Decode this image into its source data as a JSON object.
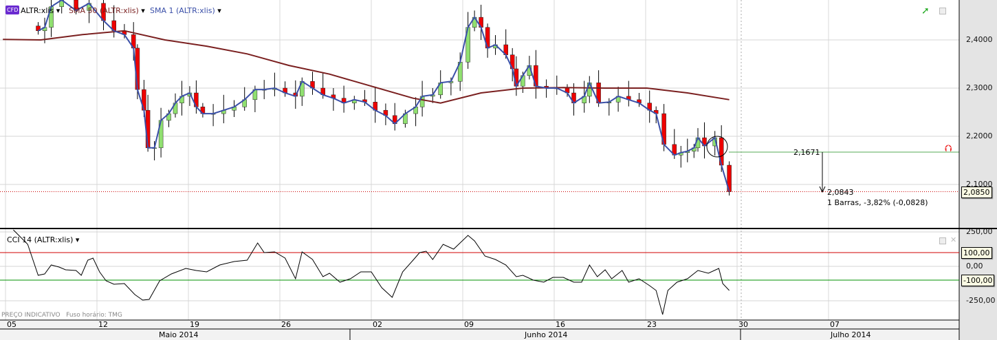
{
  "legend": {
    "symbol": "ALTR:xlis",
    "sma50": "SMA 50 (ALTR:xlis)",
    "sma1": "SMA 1 (ALTR:xlis)",
    "cfd_badge": "CFD"
  },
  "cci_legend": "CCI 14 (ALTR:xlis)",
  "footer": {
    "indicative": "PREÇO INDICATIVO",
    "timezone": "Fuso horário: TMG"
  },
  "price_tag": "2,0850",
  "cci_tags": {
    "upper": "100,00",
    "lower": "-100,00"
  },
  "measure": {
    "start": "2,1671",
    "end": "2,0843",
    "summary": "1 Barras, -3,82% (-0,0828)"
  },
  "colors": {
    "sma50": "#7a1f1f",
    "sma1": "#3a4fa8",
    "up": "#90e070",
    "down": "#ee0000",
    "cci_upper": "#d00000",
    "cci_lower": "#009000"
  },
  "chart_data": [
    {
      "type": "candlestick+line",
      "title": "ALTR:xlis",
      "ylim": [
        2.02,
        2.48
      ],
      "y_ticks": [
        "2,4000",
        "2,3000",
        "2,2000",
        "2,1000"
      ],
      "y_tick_values": [
        2.4,
        2.3,
        2.2,
        2.1
      ],
      "x_ticks": [
        "05",
        "12",
        "19",
        "26",
        "02",
        "09",
        "16",
        "23",
        "30",
        "07"
      ],
      "x_tick_days": [
        0,
        7,
        14,
        21,
        28,
        35,
        42,
        49,
        56,
        63
      ],
      "months": [
        "Maio 2014",
        "Junho 2014",
        "Julho 2014"
      ],
      "close_series": [
        [
          2.5,
          2.419
        ],
        [
          3.0,
          2.426
        ],
        [
          3.5,
          2.469
        ],
        [
          4.3,
          2.483
        ],
        [
          5.4,
          2.461
        ],
        [
          6.4,
          2.476
        ],
        [
          7.5,
          2.44
        ],
        [
          8.3,
          2.419
        ],
        [
          9.1,
          2.411
        ],
        [
          9.8,
          2.383
        ],
        [
          10.1,
          2.297
        ],
        [
          10.6,
          2.254
        ],
        [
          10.9,
          2.176
        ],
        [
          11.4,
          2.176
        ],
        [
          11.9,
          2.233
        ],
        [
          12.5,
          2.247
        ],
        [
          13.0,
          2.269
        ],
        [
          13.5,
          2.283
        ],
        [
          14.1,
          2.29
        ],
        [
          14.6,
          2.261
        ],
        [
          15.1,
          2.247
        ],
        [
          15.9,
          2.247
        ],
        [
          16.7,
          2.254
        ],
        [
          17.5,
          2.261
        ],
        [
          18.3,
          2.276
        ],
        [
          19.1,
          2.297
        ],
        [
          19.8,
          2.297
        ],
        [
          20.6,
          2.3
        ],
        [
          21.4,
          2.29
        ],
        [
          22.2,
          2.283
        ],
        [
          22.7,
          2.314
        ],
        [
          23.5,
          2.3
        ],
        [
          24.3,
          2.286
        ],
        [
          25.1,
          2.279
        ],
        [
          25.9,
          2.269
        ],
        [
          26.7,
          2.276
        ],
        [
          27.5,
          2.271
        ],
        [
          28.3,
          2.254
        ],
        [
          29.1,
          2.243
        ],
        [
          29.8,
          2.226
        ],
        [
          30.6,
          2.247
        ],
        [
          31.4,
          2.261
        ],
        [
          31.9,
          2.283
        ],
        [
          32.7,
          2.286
        ],
        [
          33.3,
          2.311
        ],
        [
          34.1,
          2.314
        ],
        [
          34.8,
          2.354
        ],
        [
          35.4,
          2.426
        ],
        [
          35.9,
          2.447
        ],
        [
          36.4,
          2.426
        ],
        [
          36.9,
          2.383
        ],
        [
          37.5,
          2.39
        ],
        [
          38.3,
          2.369
        ],
        [
          38.8,
          2.34
        ],
        [
          39.1,
          2.304
        ],
        [
          39.6,
          2.326
        ],
        [
          40.1,
          2.347
        ],
        [
          40.6,
          2.304
        ],
        [
          41.4,
          2.3
        ],
        [
          42.2,
          2.3
        ],
        [
          43.0,
          2.29
        ],
        [
          43.5,
          2.269
        ],
        [
          44.3,
          2.283
        ],
        [
          44.7,
          2.311
        ],
        [
          45.4,
          2.269
        ],
        [
          46.2,
          2.271
        ],
        [
          46.9,
          2.283
        ],
        [
          47.7,
          2.276
        ],
        [
          48.5,
          2.269
        ],
        [
          49.3,
          2.254
        ],
        [
          49.8,
          2.247
        ],
        [
          50.4,
          2.183
        ],
        [
          51.2,
          2.161
        ],
        [
          51.7,
          2.166
        ],
        [
          52.2,
          2.169
        ],
        [
          52.7,
          2.176
        ],
        [
          53.0,
          2.197
        ],
        [
          53.5,
          2.18
        ],
        [
          54.3,
          2.197
        ],
        [
          54.8,
          2.14
        ],
        [
          55.4,
          2.085
        ]
      ],
      "sma50_series": [
        [
          -0.2,
          2.401
        ],
        [
          2.7,
          2.4
        ],
        [
          5.9,
          2.411
        ],
        [
          9.1,
          2.419
        ],
        [
          12.2,
          2.4
        ],
        [
          15.4,
          2.387
        ],
        [
          18.5,
          2.371
        ],
        [
          21.7,
          2.347
        ],
        [
          24.8,
          2.329
        ],
        [
          28.0,
          2.304
        ],
        [
          31.2,
          2.279
        ],
        [
          33.3,
          2.269
        ],
        [
          36.4,
          2.29
        ],
        [
          39.6,
          2.3
        ],
        [
          42.7,
          2.301
        ],
        [
          45.9,
          2.3
        ],
        [
          49.1,
          2.3
        ],
        [
          52.2,
          2.29
        ],
        [
          55.4,
          2.276
        ]
      ],
      "last_price": 2.085,
      "measure_from": 2.1671,
      "measure_to": 2.0843
    },
    {
      "type": "line",
      "title": "CCI 14 (ALTR:xlis)",
      "ylim": [
        -400,
        300
      ],
      "y_ticks": [
        "250,00",
        "0,00",
        "-250,00"
      ],
      "y_tick_values": [
        250,
        0,
        -250
      ],
      "levels": [
        100,
        -100
      ],
      "series": [
        [
          0.6,
          300
        ],
        [
          1.7,
          160
        ],
        [
          2.5,
          -65
        ],
        [
          3.0,
          -55
        ],
        [
          3.5,
          10
        ],
        [
          4.1,
          -5
        ],
        [
          4.6,
          -25
        ],
        [
          5.4,
          -30
        ],
        [
          5.8,
          -65
        ],
        [
          6.3,
          45
        ],
        [
          6.7,
          60
        ],
        [
          7.2,
          -40
        ],
        [
          7.7,
          -105
        ],
        [
          8.3,
          -130
        ],
        [
          9.1,
          -125
        ],
        [
          9.9,
          -205
        ],
        [
          10.5,
          -245
        ],
        [
          11.0,
          -240
        ],
        [
          11.8,
          -105
        ],
        [
          12.7,
          -55
        ],
        [
          13.8,
          -15
        ],
        [
          14.6,
          -30
        ],
        [
          15.4,
          -40
        ],
        [
          16.4,
          10
        ],
        [
          17.5,
          35
        ],
        [
          18.5,
          45
        ],
        [
          19.3,
          170
        ],
        [
          19.8,
          100
        ],
        [
          20.6,
          105
        ],
        [
          21.4,
          60
        ],
        [
          22.2,
          -90
        ],
        [
          22.7,
          105
        ],
        [
          23.5,
          50
        ],
        [
          24.3,
          -75
        ],
        [
          24.8,
          -50
        ],
        [
          25.6,
          -115
        ],
        [
          26.4,
          -90
        ],
        [
          27.2,
          -40
        ],
        [
          28.0,
          -40
        ],
        [
          28.8,
          -155
        ],
        [
          29.6,
          -225
        ],
        [
          30.4,
          -40
        ],
        [
          31.2,
          45
        ],
        [
          31.7,
          100
        ],
        [
          32.2,
          110
        ],
        [
          32.7,
          50
        ],
        [
          33.5,
          160
        ],
        [
          34.3,
          125
        ],
        [
          35.4,
          225
        ],
        [
          35.9,
          185
        ],
        [
          36.7,
          75
        ],
        [
          37.5,
          50
        ],
        [
          38.3,
          10
        ],
        [
          39.1,
          -75
        ],
        [
          39.6,
          -65
        ],
        [
          40.4,
          -100
        ],
        [
          41.2,
          -115
        ],
        [
          41.9,
          -80
        ],
        [
          42.7,
          -80
        ],
        [
          43.5,
          -115
        ],
        [
          44.1,
          -115
        ],
        [
          44.7,
          10
        ],
        [
          45.3,
          -75
        ],
        [
          45.9,
          -25
        ],
        [
          46.4,
          -90
        ],
        [
          47.2,
          -30
        ],
        [
          47.7,
          -115
        ],
        [
          48.5,
          -90
        ],
        [
          49.3,
          -140
        ],
        [
          49.8,
          -175
        ],
        [
          50.3,
          -350
        ],
        [
          50.7,
          -175
        ],
        [
          51.4,
          -115
        ],
        [
          52.2,
          -90
        ],
        [
          53.0,
          -30
        ],
        [
          53.8,
          -50
        ],
        [
          54.6,
          -15
        ],
        [
          54.9,
          -125
        ],
        [
          55.4,
          -175
        ]
      ]
    }
  ]
}
